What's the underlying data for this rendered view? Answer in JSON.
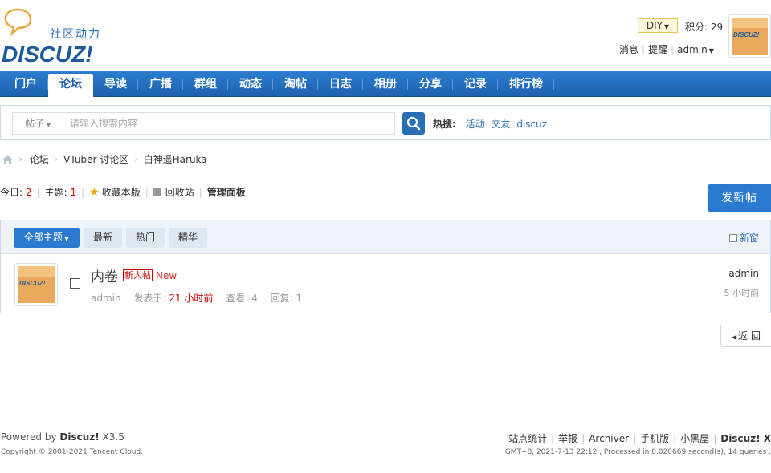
{
  "logo": {
    "slogan": "社区动力",
    "wordmark": "DISCUZ!"
  },
  "user_bar": {
    "diy_label": "DIY",
    "score_label": "积分: 29",
    "messages": "消息",
    "reminders": "提醒",
    "username": "admin",
    "avatar_text": "DISCUZ!"
  },
  "nav": {
    "items": [
      {
        "label": "门户"
      },
      {
        "label": "论坛"
      },
      {
        "label": "导读"
      },
      {
        "label": "广播"
      },
      {
        "label": "群组"
      },
      {
        "label": "动态"
      },
      {
        "label": "淘帖"
      },
      {
        "label": "日志"
      },
      {
        "label": "相册"
      },
      {
        "label": "分享"
      },
      {
        "label": "记录"
      },
      {
        "label": "排行榜"
      }
    ],
    "active_index": 1
  },
  "search": {
    "category": "帖子",
    "placeholder": "请输入搜索内容",
    "hot_label": "热搜:",
    "hot_terms": [
      "活动",
      "交友",
      "discuz"
    ]
  },
  "breadcrumb": {
    "items": [
      "论坛",
      "VTuber 讨论区",
      "白神遥Haruka"
    ]
  },
  "forum_info": {
    "today_label": "今日:",
    "today_value": "2",
    "topics_label": "主题:",
    "topics_value": "1",
    "favorite": "收藏本版",
    "recycle": "回收站",
    "manage": "管理面板",
    "new_post": "发新帖"
  },
  "thread_tabs": {
    "all": "全部主题",
    "latest": "最新",
    "hot": "热门",
    "digest": "精华",
    "new_window": "新窗"
  },
  "threads": [
    {
      "title": "内卷",
      "tag": "新人帖",
      "new_label": "New",
      "author": "admin",
      "posted_label": "发表于:",
      "posted_time": "21 小时前",
      "views": "查看: 4",
      "replies": "回复: 1",
      "last_poster": "admin",
      "last_time": "5 小时前",
      "avatar_text": "DISCUZ!"
    }
  ],
  "back_label": "返 回",
  "footer": {
    "powered_prefix": "Powered by ",
    "powered_brand": "Discuz!",
    "powered_version": " X3.5",
    "copyright": "Copyright © 2001-2021 Tencent Cloud.",
    "links": [
      "站点统计",
      "举报",
      "Archiver",
      "手机版",
      "小黑屋"
    ],
    "brand_link": "Discuz! X",
    "stats": "GMT+8, 2021-7-13 22:12 , Processed in 0.020669 second(s), 14 queries ."
  },
  "colors": {
    "nav_blue": "#1e63ae",
    "link_blue": "#2a6fb6",
    "button_blue": "#2a7ad0",
    "red": "#cc0000"
  }
}
